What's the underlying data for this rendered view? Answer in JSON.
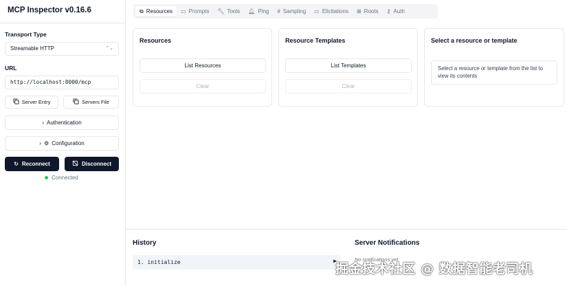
{
  "app": {
    "title": "MCP Inspector v0.16.6"
  },
  "sidebar": {
    "transport_label": "Transport Type",
    "transport_value": "Streamable HTTP",
    "url_label": "URL",
    "url_value": "http://localhost:8000/mcp",
    "server_entry_label": "Server Entry",
    "servers_file_label": "Servers File",
    "authentication_label": "Authentication",
    "configuration_label": "Configuration",
    "reconnect_label": "Reconnect",
    "disconnect_label": "Disconnect",
    "status_text": "Connected",
    "status_color": "#22c55e"
  },
  "tabs": [
    {
      "label": "Resources",
      "icon": "resources-icon",
      "active": true
    },
    {
      "label": "Prompts",
      "icon": "prompts-icon"
    },
    {
      "label": "Tools",
      "icon": "tools-icon"
    },
    {
      "label": "Ping",
      "icon": "bell-icon"
    },
    {
      "label": "Sampling",
      "icon": "hash-icon"
    },
    {
      "label": "Elicitations",
      "icon": "message-icon"
    },
    {
      "label": "Roots",
      "icon": "folder-tree-icon"
    },
    {
      "label": "Auth",
      "icon": "key-icon"
    }
  ],
  "resources_panel": {
    "title": "Resources",
    "list_button": "List Resources",
    "clear_button": "Clear"
  },
  "templates_panel": {
    "title": "Resource Templates",
    "list_button": "List Templates",
    "clear_button": "Clear"
  },
  "detail_panel": {
    "title": "Select a resource or template",
    "hint": "Select a resource or template from the list to view its contents"
  },
  "history": {
    "title": "History",
    "items": [
      {
        "text": "1. initialize"
      }
    ]
  },
  "notifications": {
    "title": "Server Notifications",
    "empty_text": "No notifications yet"
  },
  "watermark": {
    "text": "掘金技术社区 @ 数据智能老司机"
  },
  "colors": {
    "accent_dark": "#0f172a",
    "border": "#e5e7eb",
    "muted": "#6b7280"
  }
}
